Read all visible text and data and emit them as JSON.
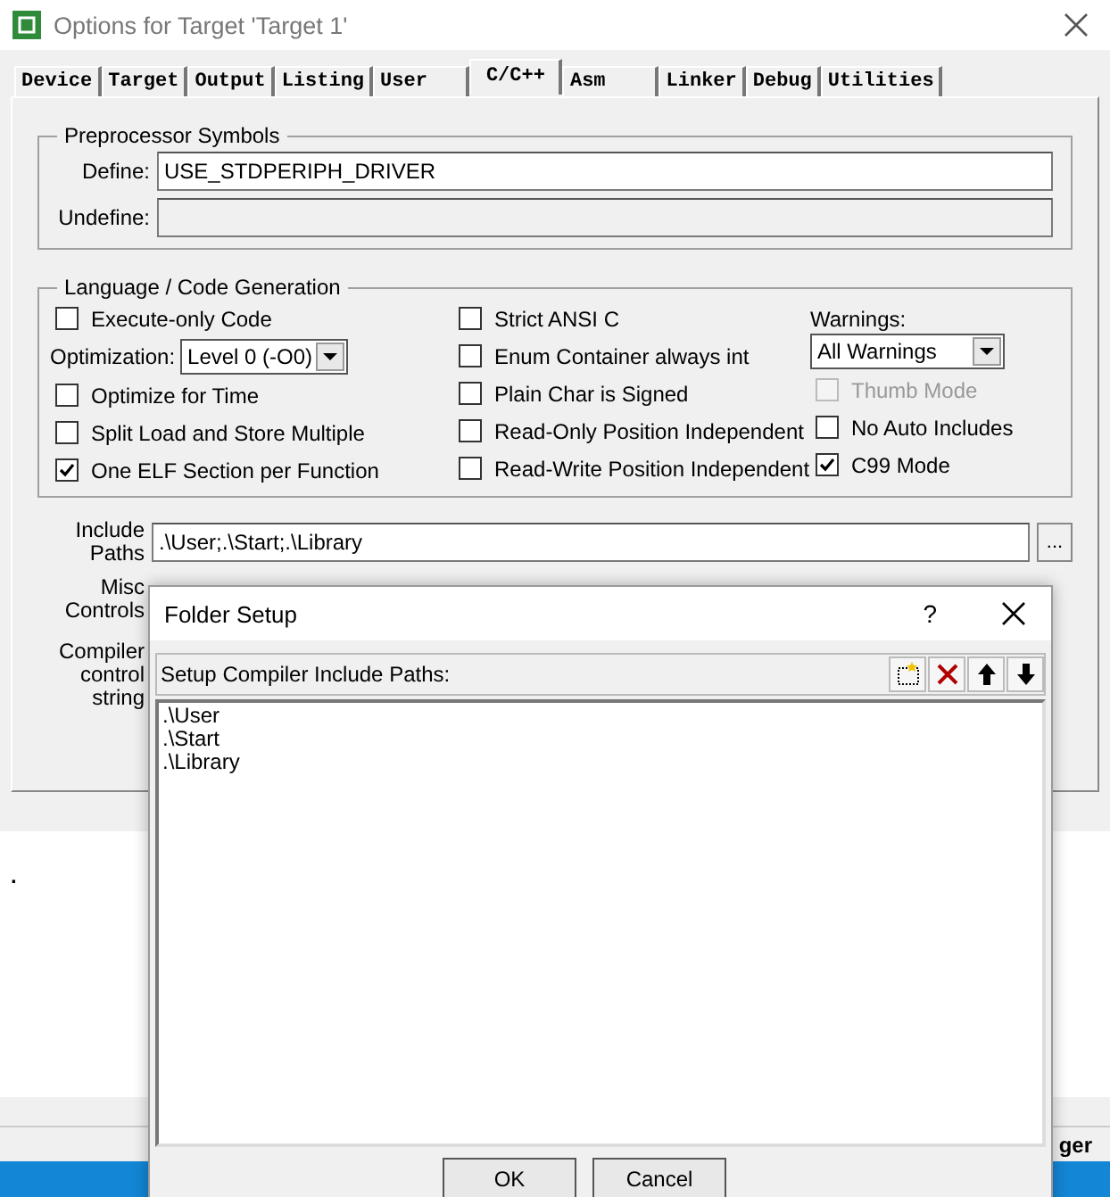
{
  "window": {
    "title": "Options for Target 'Target 1'"
  },
  "tabs": [
    {
      "label": "Device",
      "selected": false
    },
    {
      "label": "Target",
      "selected": false
    },
    {
      "label": "Output",
      "selected": false
    },
    {
      "label": "Listing",
      "selected": false
    },
    {
      "label": "User",
      "selected": false
    },
    {
      "label": "C/C++",
      "selected": true
    },
    {
      "label": "Asm",
      "selected": false
    },
    {
      "label": "Linker",
      "selected": false
    },
    {
      "label": "Debug",
      "selected": false
    },
    {
      "label": "Utilities",
      "selected": false
    }
  ],
  "preprocessor": {
    "title": "Preprocessor Symbols",
    "fields": [
      {
        "label": "Define:",
        "value": "USE_STDPERIPH_DRIVER",
        "disabled": false
      },
      {
        "label": "Undefine:",
        "disabled": true
      }
    ]
  },
  "codegen": {
    "title": "Language / Code Generation",
    "columns": [
      [
        {
          "kind": "checkbox",
          "label": "Execute-only Code",
          "checked": false,
          "disabled": false
        },
        {
          "kind": "dropdown",
          "label": "Optimization:",
          "value": "Level 0 (-O0)"
        },
        {
          "kind": "checkbox",
          "label": "Optimize for Time",
          "checked": false,
          "disabled": false
        },
        {
          "kind": "checkbox",
          "label": "Split Load and Store Multiple",
          "checked": false,
          "disabled": false
        },
        {
          "kind": "checkbox",
          "label": "One ELF Section per Function",
          "checked": true,
          "disabled": false
        }
      ],
      [
        {
          "kind": "checkbox",
          "label": "Strict ANSI C",
          "checked": false,
          "disabled": false
        },
        {
          "kind": "checkbox",
          "label": "Enum Container always int",
          "checked": false,
          "disabled": false
        },
        {
          "kind": "checkbox",
          "label": "Plain Char is Signed",
          "checked": false,
          "disabled": false
        },
        {
          "kind": "checkbox",
          "label": "Read-Only Position Independent",
          "checked": false,
          "disabled": false
        },
        {
          "kind": "checkbox",
          "label": "Read-Write Position Independent",
          "checked": false,
          "disabled": false
        }
      ],
      [
        {
          "kind": "label",
          "label": "Warnings:"
        },
        {
          "kind": "dropdown",
          "value": "All Warnings"
        },
        {
          "kind": "checkbox",
          "label": "Thumb Mode",
          "checked": false,
          "disabled": true
        },
        {
          "kind": "checkbox",
          "label": "No Auto Includes",
          "checked": false,
          "disabled": false
        },
        {
          "kind": "checkbox",
          "label": "C99 Mode",
          "checked": true,
          "disabled": false
        }
      ]
    ]
  },
  "include_paths": {
    "label": "Include Paths",
    "value": ".\\User;.\\Start;.\\Library",
    "browse": "..."
  },
  "misc_controls": {
    "label": "Misc Controls"
  },
  "compiler_control": {
    "label": "Compiler control string"
  },
  "editor": {
    "text": "."
  },
  "status_bar": {
    "text": "ger"
  },
  "folder_setup": {
    "title": "Folder Setup",
    "help": "?",
    "caption": "Setup Compiler Include Paths:",
    "paths": [
      ".\\User",
      ".\\Start",
      ".\\Library"
    ],
    "buttons": [
      "OK",
      "Cancel"
    ]
  }
}
